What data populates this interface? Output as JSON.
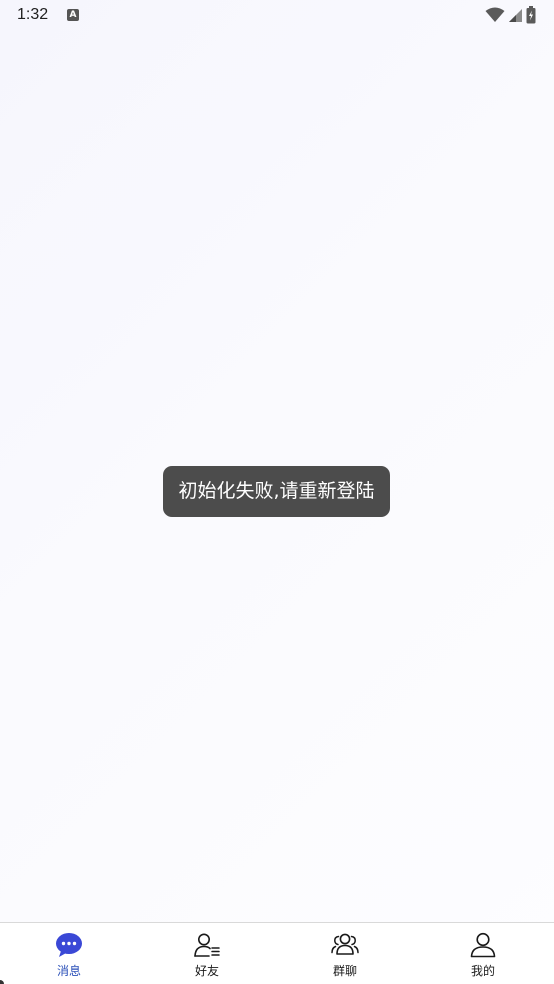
{
  "status_bar": {
    "time": "1:32",
    "a_badge": "A"
  },
  "toast": {
    "message": "初始化失败,请重新登陆"
  },
  "tab_bar": {
    "active_color": "#3a48d6",
    "tabs": [
      {
        "label": "消息",
        "icon": "chat-bubble-icon",
        "active": true
      },
      {
        "label": "好友",
        "icon": "friends-icon",
        "active": false
      },
      {
        "label": "群聊",
        "icon": "group-icon",
        "active": false
      },
      {
        "label": "我的",
        "icon": "profile-icon",
        "active": false
      }
    ]
  }
}
